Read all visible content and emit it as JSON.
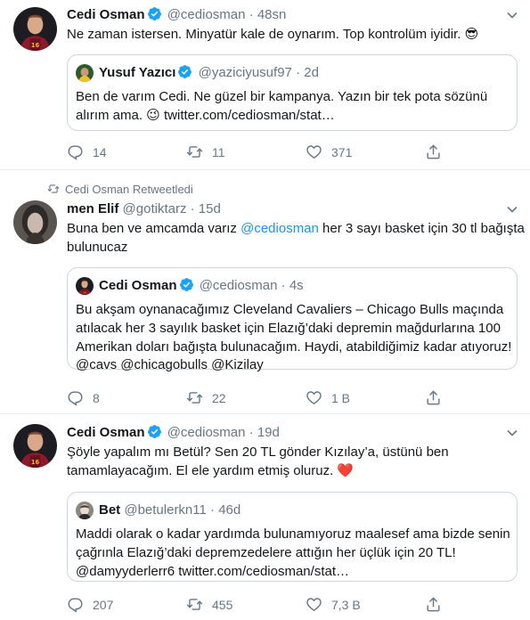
{
  "tweets": [
    {
      "author": "Cedi Osman",
      "handle": "@cediosman",
      "sep": "·",
      "time": "48sn",
      "lines": [
        "Ne zaman istersen. Minyatür kale de oynarım. Top kontrolüm iyidir. 😎"
      ],
      "quote": {
        "author": "Yusuf Yazıcı",
        "handle": "@yaziciyusuf97",
        "sep": "·",
        "time": "2d",
        "lines": [
          "Ben de varım Cedi. Ne güzel bir kampanya. Yazın bir tek pota sözünü",
          "alırım ama. 😉 twitter.com/cediosman/stat…"
        ]
      },
      "replies": "14",
      "retweets": "11",
      "likes": "371"
    },
    {
      "retweet_note": "Cedi Osman Retweetledi",
      "author": "men Elif",
      "handle": "@gotiktarz",
      "sep": "·",
      "time": "15d",
      "line1_before": "Buna ben ve amcamda varız ",
      "line1_mention": "@cediosman",
      "line1_after": " her 3 sayı basket için 30 tl bağışta",
      "line2": "bulunucaz",
      "quote": {
        "author": "Cedi Osman",
        "handle": "@cediosman",
        "sep": "·",
        "time": "4s",
        "lines": [
          "Bu akşam oynanacağımız Cleveland Cavaliers – Chicago Bulls maçında",
          "atılacak her 3 sayılık basket için Elazığ’daki depremin mağdurlarına 100",
          "Amerikan doları bağışta bulunacağım. Haydi, atabildiğimiz kadar atıyoruz!",
          "@cavs @chicagobulls @Kizilay"
        ]
      },
      "replies": "8",
      "retweets": "22",
      "likes": "1 B"
    },
    {
      "author": "Cedi Osman",
      "handle": "@cediosman",
      "sep": "·",
      "time": "19d",
      "lines": [
        "Şöyle yapalım mı Betül? Sen 20 TL gönder Kızılay’a, üstünü ben",
        "tamamlayacağım. El ele yardım etmiş oluruz. ❤️"
      ],
      "quote": {
        "author": "Bet",
        "handle": "@betulerkn11",
        "sep": "·",
        "time": "46d",
        "lines": [
          "Maddi olarak o kadar yardımda bulunamıyoruz maalesef ama bizde senin",
          "çağrınla Elazığ’daki depremzedelere attığın her üçlük için 20 TL!",
          "@damyyderlerr6 twitter.com/cediosman/stat…"
        ]
      },
      "replies": "207",
      "retweets": "455",
      "likes": "7,3 B"
    }
  ],
  "colors": {
    "accent": "#1da1f2",
    "link": "#1b95e0",
    "muted": "#657786",
    "border": "#e6ecf0"
  }
}
